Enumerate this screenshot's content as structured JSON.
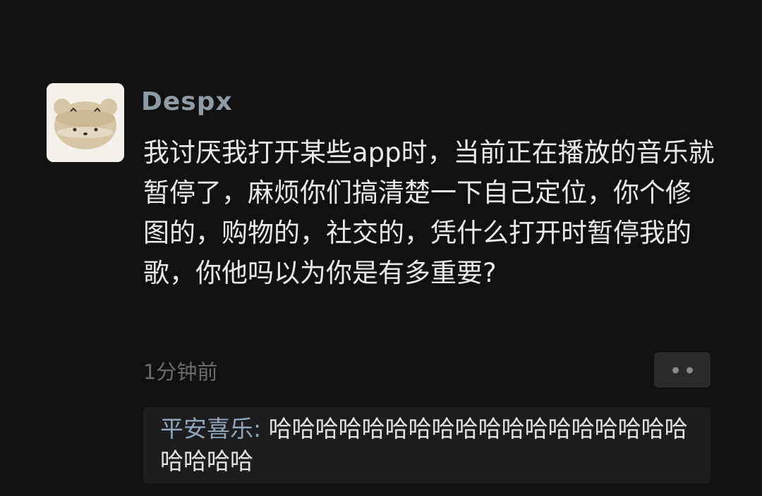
{
  "post": {
    "username": "Despx",
    "avatar_icon": "bear-avatar-icon",
    "message": "我讨厌我打开某些app时，当前正在播放的音乐就暂停了，麻烦你们搞清楚一下自己定位，你个修图的，购物的，社交的，凭什么打开时暂停我的歌，你他吗以为你是有多重要?",
    "timestamp": "1分钟前",
    "more_icon": "more-dots-icon"
  },
  "reply": {
    "author": "平安喜乐",
    "separator": ": ",
    "text": "哈哈哈哈哈哈哈哈哈哈哈哈哈哈哈哈哈哈哈哈哈哈"
  },
  "colors": {
    "background": "#111112",
    "username": "#8f9ba4",
    "message_text": "#e9e9e9",
    "timestamp": "#6a6a6d",
    "reply_author": "#8fa6bb",
    "reply_background": "#1d1d1f"
  }
}
